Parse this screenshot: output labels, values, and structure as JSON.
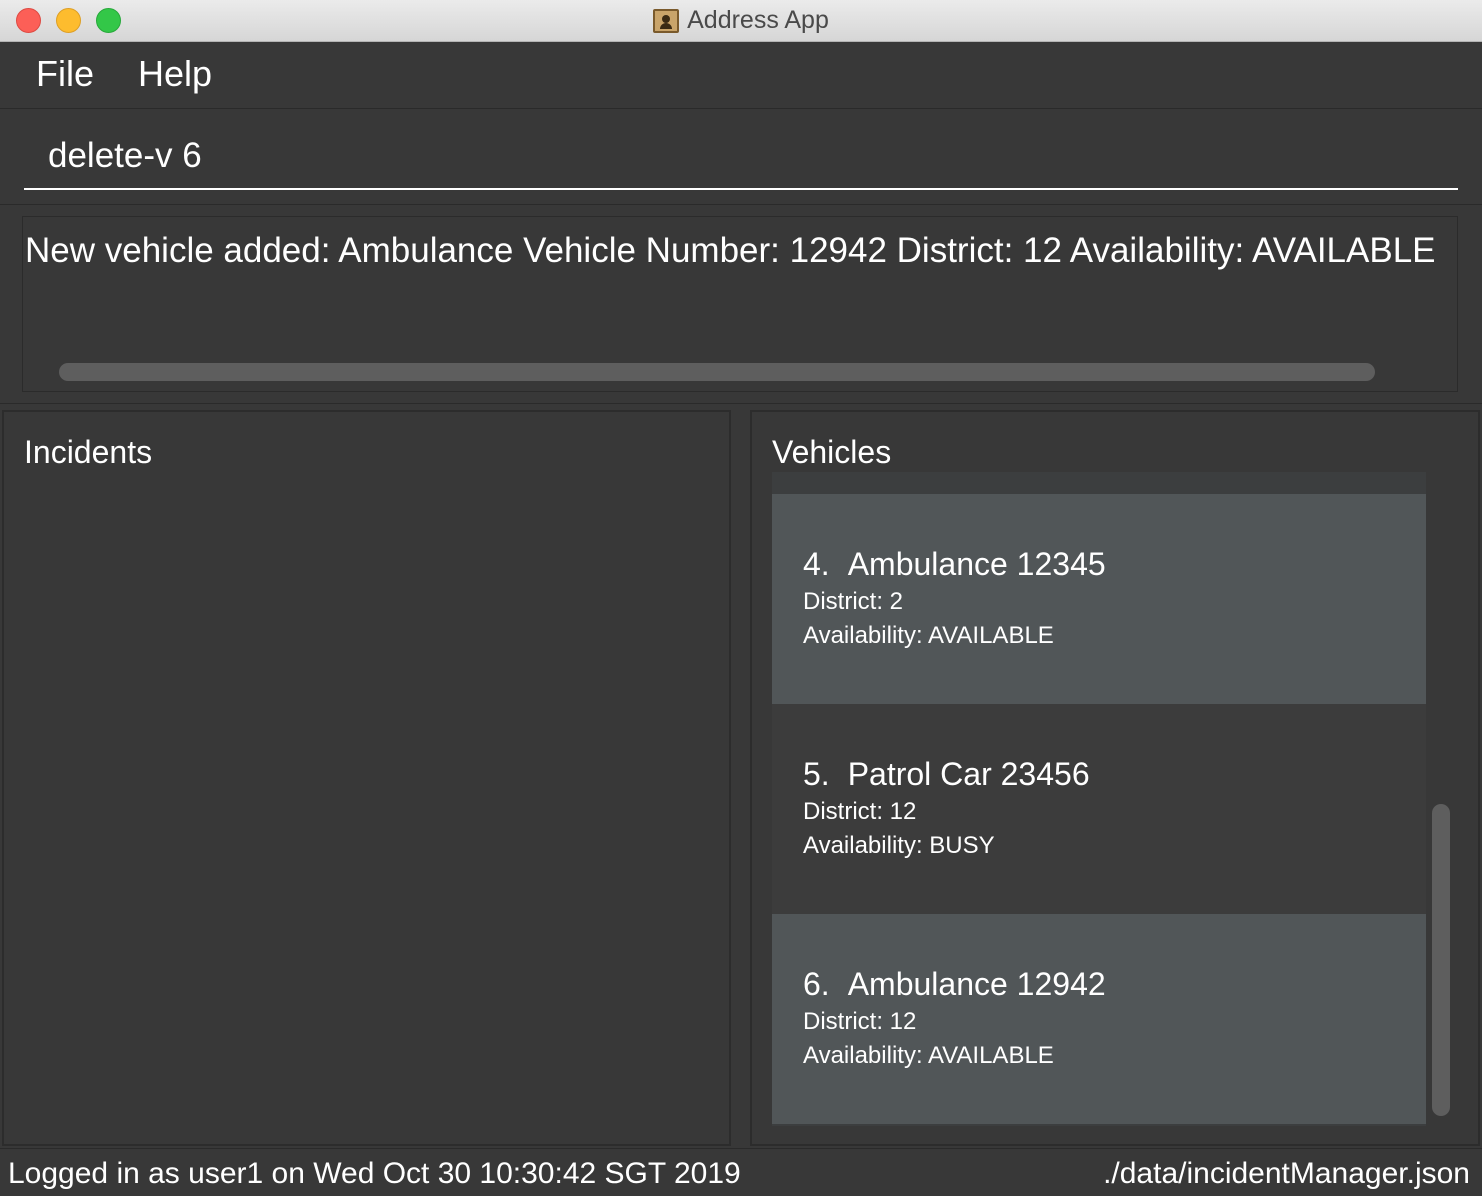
{
  "window": {
    "title": "Address App",
    "icon": "address-book-icon"
  },
  "menu": {
    "file_label": "File",
    "help_label": "Help"
  },
  "command": {
    "value": "delete-v 6"
  },
  "result": {
    "text": "New vehicle added: Ambulance Vehicle Number: 12942 District: 12 Availability: AVAILABLE"
  },
  "incidents_panel": {
    "title": "Incidents",
    "items": []
  },
  "vehicles_panel": {
    "title": "Vehicles",
    "items": [
      {
        "index": "4.",
        "name": "Ambulance 12345",
        "district": "District: 2",
        "availability": "Availability: AVAILABLE"
      },
      {
        "index": "5.",
        "name": "Patrol Car 23456",
        "district": "District: 12",
        "availability": "Availability: BUSY"
      },
      {
        "index": "6.",
        "name": "Ambulance 12942",
        "district": "District: 12",
        "availability": "Availability: AVAILABLE"
      }
    ]
  },
  "status": {
    "login": "Logged in as user1 on Wed Oct 30 10:30:42 SGT 2019",
    "file_path": "./data/incidentManager.json"
  },
  "colors": {
    "background": "#383838",
    "card_highlight": "#515658",
    "card_plain": "#3c3c3c",
    "text": "#ffffff"
  }
}
